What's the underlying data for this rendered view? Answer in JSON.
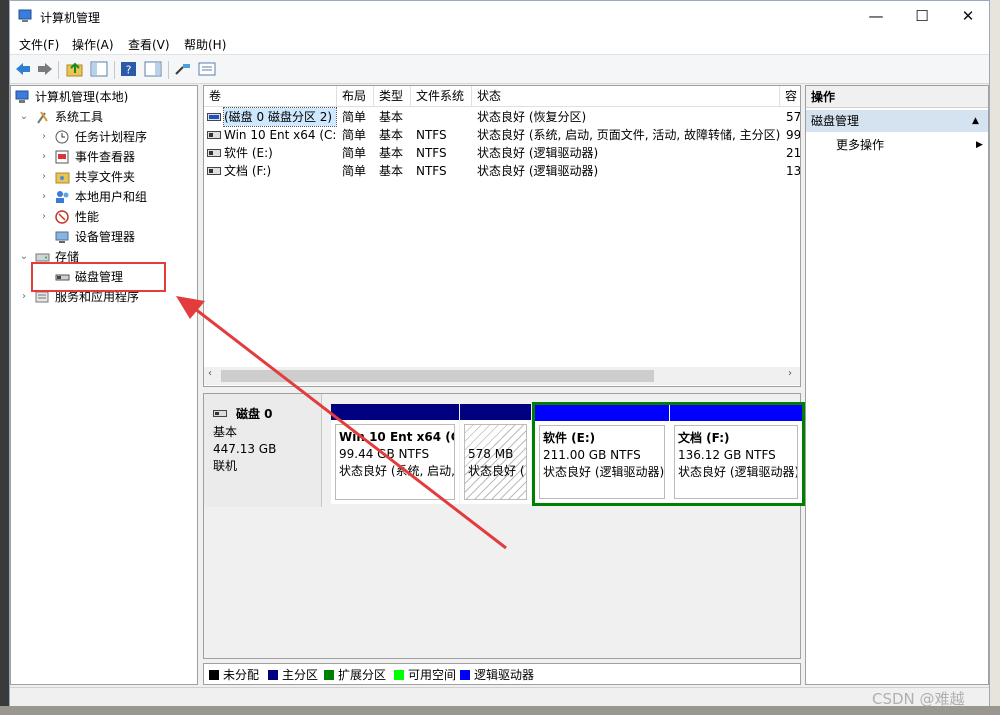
{
  "window": {
    "title": "计算机管理",
    "minimize": "—",
    "maximize": "☐",
    "close": "✕"
  },
  "menu": [
    "文件(F)",
    "操作(A)",
    "查看(V)",
    "帮助(H)"
  ],
  "tree": {
    "root": "计算机管理(本地)",
    "system_tools": "系统工具",
    "task_scheduler": "任务计划程序",
    "event_viewer": "事件查看器",
    "shared_folders": "共享文件夹",
    "local_users": "本地用户和组",
    "performance": "性能",
    "device_manager": "设备管理器",
    "storage": "存储",
    "disk_management": "磁盘管理",
    "services": "服务和应用程序"
  },
  "volumes": {
    "headers": [
      "卷",
      "布局",
      "类型",
      "文件系统",
      "状态",
      "容"
    ],
    "rows": [
      {
        "name": "(磁盘 0 磁盘分区 2)",
        "layout": "简单",
        "type": "基本",
        "fs": "",
        "status": "状态良好 (恢复分区)",
        "cap": "57"
      },
      {
        "name": "Win 10 Ent x64 (C:)",
        "layout": "简单",
        "type": "基本",
        "fs": "NTFS",
        "status": "状态良好 (系统, 启动, 页面文件, 活动, 故障转储, 主分区)",
        "cap": "99"
      },
      {
        "name": "软件 (E:)",
        "layout": "简单",
        "type": "基本",
        "fs": "NTFS",
        "status": "状态良好 (逻辑驱动器)",
        "cap": "21"
      },
      {
        "name": "文档 (F:)",
        "layout": "简单",
        "type": "基本",
        "fs": "NTFS",
        "status": "状态良好 (逻辑驱动器)",
        "cap": "13"
      }
    ]
  },
  "actions": {
    "header": "操作",
    "section": "磁盘管理",
    "more": "更多操作"
  },
  "disk": {
    "name": "磁盘 0",
    "kind": "基本",
    "size": "447.13 GB",
    "state": "联机",
    "partitions": [
      {
        "title": "Win 10 Ent x64 (C",
        "size": "99.44 GB NTFS",
        "status": "状态良好 (系统, 启动,"
      },
      {
        "title": "",
        "size": "578 MB",
        "status": "状态良好 ("
      },
      {
        "title": "软件 (E:)",
        "size": "211.00 GB NTFS",
        "status": "状态良好 (逻辑驱动器)"
      },
      {
        "title": "文档 (F:)",
        "size": "136.12 GB NTFS",
        "status": "状态良好 (逻辑驱动器)"
      }
    ]
  },
  "legend": [
    {
      "label": "未分配",
      "color": "#000000"
    },
    {
      "label": "主分区",
      "color": "#000080"
    },
    {
      "label": "扩展分区",
      "color": "#008000"
    },
    {
      "label": "可用空间",
      "color": "#00ff00"
    },
    {
      "label": "逻辑驱动器",
      "color": "#0000ff"
    }
  ],
  "watermark": "CSDN @难越",
  "colors": {
    "primary_bar": "#000080",
    "logical_bar": "#0000ff",
    "extended_border": "#008000",
    "highlight": "#e23c3c"
  }
}
